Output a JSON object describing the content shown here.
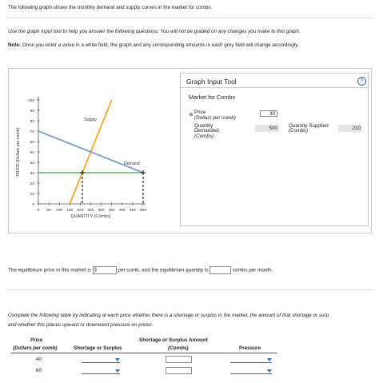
{
  "intro": "The following graph shows the monthly demand and supply curves in the market for combs.",
  "instructions": "Use the graph input tool to help you answer the following questions. You will not be graded on any changes you make to this graph.",
  "note_label": "Note:",
  "note_text": "Once you enter a value in a white field, the graph and any corresponding amounts in each grey field will change accordingly.",
  "tool": {
    "title": "Graph Input Tool",
    "help_icon": "question-circle-icon",
    "help_glyph": "?",
    "market_title": "Market for Combs",
    "price_label": "Price",
    "price_unit": "(Dollars per comb)",
    "price_value": "30",
    "qd_label_1": "Quantity",
    "qd_label_2": "Demanded",
    "qd_unit": "(Combs)",
    "qd_value": "500",
    "qs_label": "Quantity Supplied",
    "qs_unit": "(Combs)",
    "qs_value": "210"
  },
  "chart_data": {
    "type": "line",
    "ylabel": "PRICE (Dollars per comb)",
    "xlabel": "QUANTITY (Combs)",
    "xlim": [
      0,
      500
    ],
    "ylim": [
      0,
      100
    ],
    "xticks": [
      0,
      50,
      100,
      150,
      200,
      250,
      300,
      350,
      400,
      450,
      500
    ],
    "yticks": [
      0,
      10,
      20,
      30,
      40,
      50,
      60,
      70,
      80,
      90,
      100
    ],
    "series": [
      {
        "name": "Supply",
        "color": "#f5a623",
        "x": [
          150,
          350
        ],
        "y": [
          0,
          100
        ]
      },
      {
        "name": "Demand",
        "color": "#7a9fcf",
        "x": [
          0,
          500
        ],
        "y": [
          70,
          30
        ]
      }
    ],
    "price_line": {
      "value": 30,
      "color": "#5cb85c"
    },
    "markers": [
      {
        "x": 210,
        "y": 30
      },
      {
        "x": 500,
        "y": 30
      }
    ]
  },
  "q1": {
    "before": "The equilibrium price in this market is",
    "dollar": "$",
    "middle": "per comb, and the equilibrium quantity is",
    "after": "combs per month."
  },
  "q2": {
    "text_1": "Complete the following table by indicating at each price whether there is a shortage or surplus in the market, the amount of that shortage or surp",
    "text_2": "and whether this places upward or downward pressure on prices."
  },
  "table": {
    "col1_head_1": "Price",
    "col1_head_2": "(Dollars per comb)",
    "col2_head": "Shortage or Surplus",
    "col3_head_1": "Shortage or Surplus Amount",
    "col3_head_2": "(Combs)",
    "col4_head": "Pressure",
    "rows": [
      {
        "price": "40"
      },
      {
        "price": "60"
      }
    ]
  }
}
